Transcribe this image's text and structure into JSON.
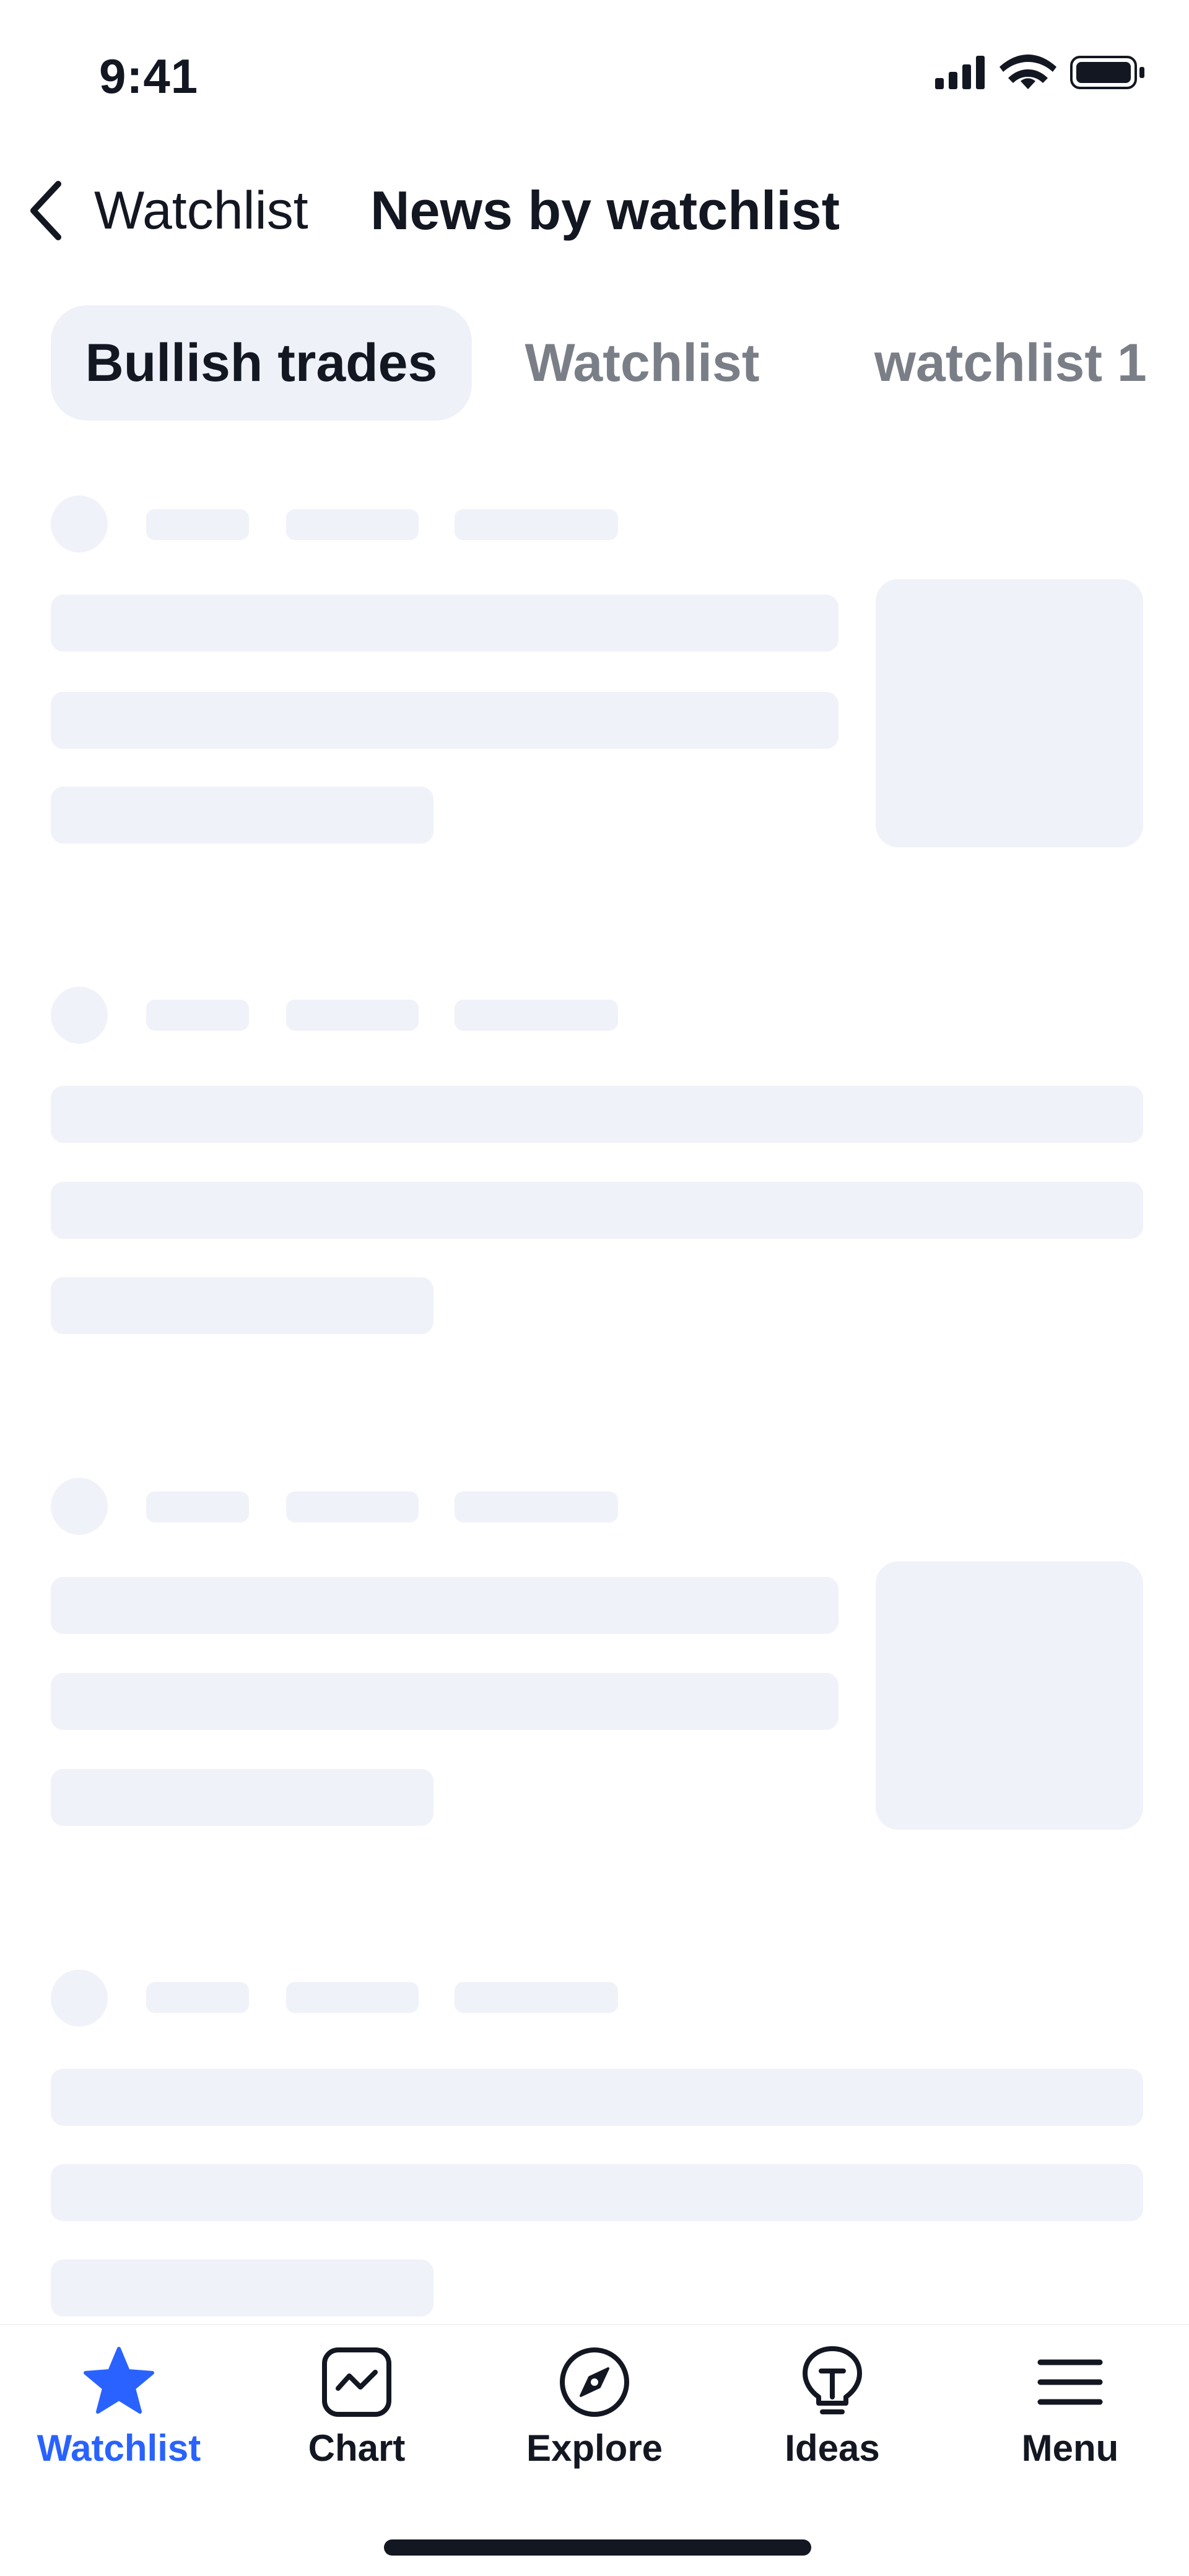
{
  "status_bar": {
    "time": "9:41",
    "icons": [
      "cellular-signal-icon",
      "wifi-icon",
      "battery-icon"
    ]
  },
  "nav": {
    "back_label": "Watchlist",
    "back_icon": "chevron-left-icon",
    "title": "News by watchlist"
  },
  "tabs": [
    {
      "label": "Bullish trades",
      "active": true
    },
    {
      "label": "Watchlist",
      "active": false
    },
    {
      "label": "watchlist 1",
      "active": false
    }
  ],
  "news_list": {
    "state": "loading-skeleton",
    "items": [
      {
        "has_thumbnail": true
      },
      {
        "has_thumbnail": false
      },
      {
        "has_thumbnail": true
      },
      {
        "has_thumbnail": false
      }
    ]
  },
  "tab_bar": {
    "items": [
      {
        "label": "Watchlist",
        "icon": "star-icon",
        "active": true
      },
      {
        "label": "Chart",
        "icon": "chart-icon",
        "active": false
      },
      {
        "label": "Explore",
        "icon": "compass-icon",
        "active": false
      },
      {
        "label": "Ideas",
        "icon": "lightbulb-icon",
        "active": false
      },
      {
        "label": "Menu",
        "icon": "menu-icon",
        "active": false
      }
    ]
  },
  "colors": {
    "accent": "#2962ff",
    "text": "#131722",
    "muted_text": "#7a7e87",
    "skeleton": "#eff2f9",
    "active_tab_bg": "#eef1f8"
  }
}
